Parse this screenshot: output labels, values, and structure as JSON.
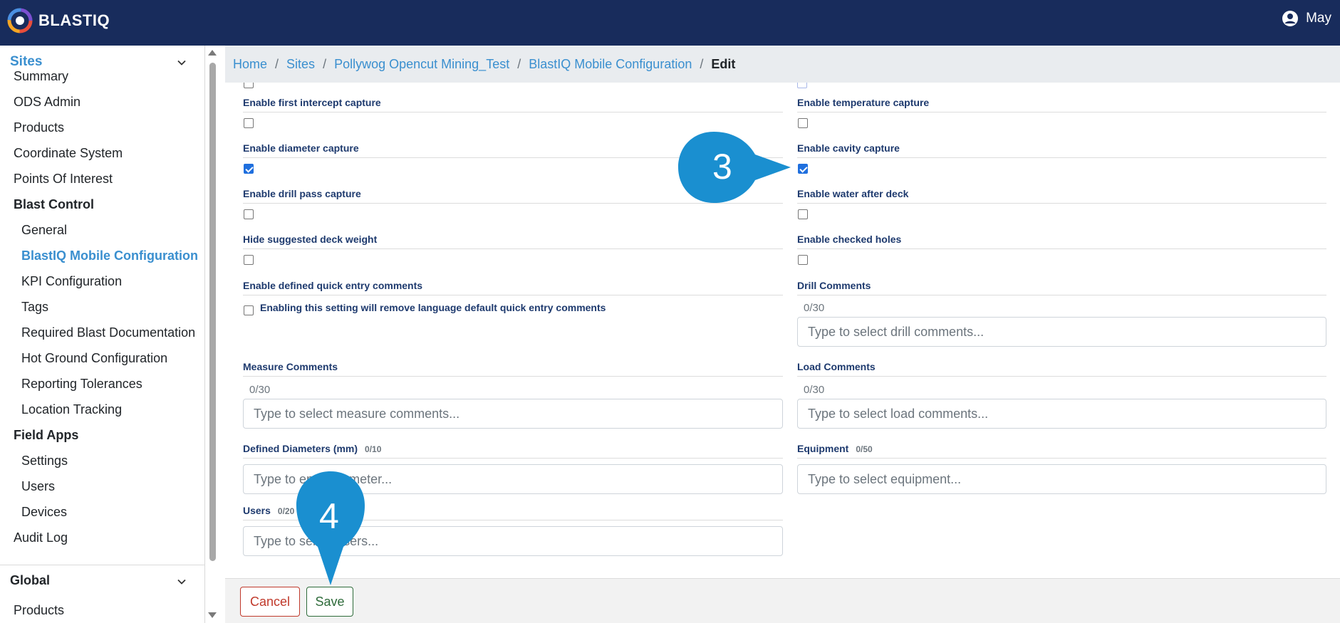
{
  "header": {
    "brand": "BLASTIQ",
    "user_name": "May"
  },
  "sidebar": {
    "sites_label": "Sites",
    "global_label": "Global",
    "items": [
      {
        "label": "Summary"
      },
      {
        "label": "ODS Admin"
      },
      {
        "label": "Products"
      },
      {
        "label": "Coordinate System"
      },
      {
        "label": "Points Of Interest"
      },
      {
        "label": "Blast Control"
      },
      {
        "label": "General"
      },
      {
        "label": "BlastIQ Mobile Configuration"
      },
      {
        "label": "KPI Configuration"
      },
      {
        "label": "Tags"
      },
      {
        "label": "Required Blast Documentation"
      },
      {
        "label": "Hot Ground Configuration"
      },
      {
        "label": "Reporting Tolerances"
      },
      {
        "label": "Location Tracking"
      },
      {
        "label": "Field Apps"
      },
      {
        "label": "Settings"
      },
      {
        "label": "Users"
      },
      {
        "label": "Devices"
      },
      {
        "label": "Audit Log"
      },
      {
        "label": "Products"
      }
    ]
  },
  "breadcrumb": {
    "home": "Home",
    "sites": "Sites",
    "site": "Pollywog Opencut Mining_Test",
    "config": "BlastIQ Mobile Configuration",
    "current": "Edit",
    "separator": "/"
  },
  "form": {
    "first_intercept": {
      "label": "Enable first intercept capture",
      "checked": false
    },
    "temperature": {
      "label": "Enable temperature capture",
      "checked": false
    },
    "diameter": {
      "label": "Enable diameter capture",
      "checked": true
    },
    "cavity": {
      "label": "Enable cavity capture",
      "checked": true
    },
    "drill_pass": {
      "label": "Enable drill pass capture",
      "checked": false
    },
    "water_after_deck": {
      "label": "Enable water after deck",
      "checked": false
    },
    "hide_deck_weight": {
      "label": "Hide suggested deck weight",
      "checked": false
    },
    "checked_holes": {
      "label": "Enable checked holes",
      "checked": false
    },
    "quick_entry": {
      "label": "Enable defined quick entry comments",
      "note": "Enabling this setting will remove language default quick entry comments",
      "checked": false
    },
    "drill_comments": {
      "label": "Drill Comments",
      "counter": "0/30",
      "placeholder": "Type to select drill comments..."
    },
    "measure_comments": {
      "label": "Measure Comments",
      "counter": "0/30",
      "placeholder": "Type to select measure comments..."
    },
    "load_comments": {
      "label": "Load Comments",
      "counter": "0/30",
      "placeholder": "Type to select load comments..."
    },
    "defined_diameters": {
      "label": "Defined Diameters (mm)",
      "counter": "0/10",
      "placeholder": "Type to enter diameter..."
    },
    "equipment": {
      "label": "Equipment",
      "counter": "0/50",
      "placeholder": "Type to select equipment..."
    },
    "users": {
      "label": "Users",
      "counter": "0/20",
      "placeholder": "Type to select users..."
    }
  },
  "footer": {
    "cancel": "Cancel",
    "save": "Save"
  },
  "callouts": {
    "three": "3",
    "four": "4",
    "color": "#1a8fd0"
  }
}
